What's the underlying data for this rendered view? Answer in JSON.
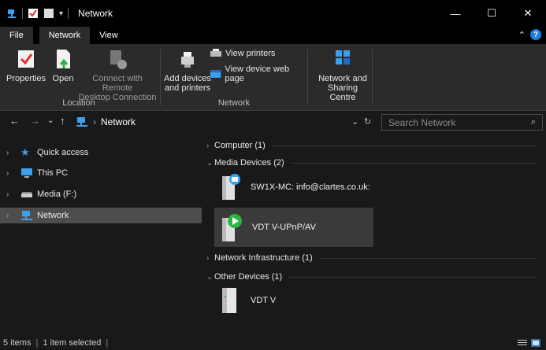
{
  "window": {
    "title": "Network",
    "min": "—",
    "max": "☐",
    "close": "✕"
  },
  "ribbon_tabs": [
    {
      "label": "File"
    },
    {
      "label": "Network"
    },
    {
      "label": "View"
    }
  ],
  "ribbon": {
    "location_group": {
      "label": "Location",
      "properties": "Properties",
      "open": "Open",
      "connect_line1": "Connect with Remote",
      "connect_line2": "Desktop Connection"
    },
    "network_group": {
      "label": "Network",
      "add_devices_line1": "Add devices",
      "add_devices_line2": "and printers",
      "view_printers": "View printers",
      "view_device_web_page": "View device web page"
    },
    "sharing_group": {
      "line1": "Network and",
      "line2": "Sharing Centre"
    }
  },
  "address": {
    "location": "Network",
    "search_placeholder": "Search Network"
  },
  "nav_pane": [
    {
      "label": "Quick access"
    },
    {
      "label": "This PC"
    },
    {
      "label": "Media (F:)"
    },
    {
      "label": "Network"
    }
  ],
  "content": {
    "groups": [
      {
        "label": "Computer (1)",
        "expanded": false
      },
      {
        "label": "Media Devices (2)",
        "expanded": true
      },
      {
        "label": "Network Infrastructure (1)",
        "expanded": false
      },
      {
        "label": "Other Devices (1)",
        "expanded": true
      }
    ],
    "items": [
      {
        "label": "SW1X-MC: info@clartes.co.uk:"
      },
      {
        "label": "VDT V-UPnP/AV"
      },
      {
        "label": "VDT V"
      }
    ]
  },
  "status": {
    "item_count": "5 items",
    "selection": "1 item selected"
  },
  "colors": {
    "accent": "#1e7fe0",
    "background": "#191919",
    "selection": "#4d4d4d"
  }
}
